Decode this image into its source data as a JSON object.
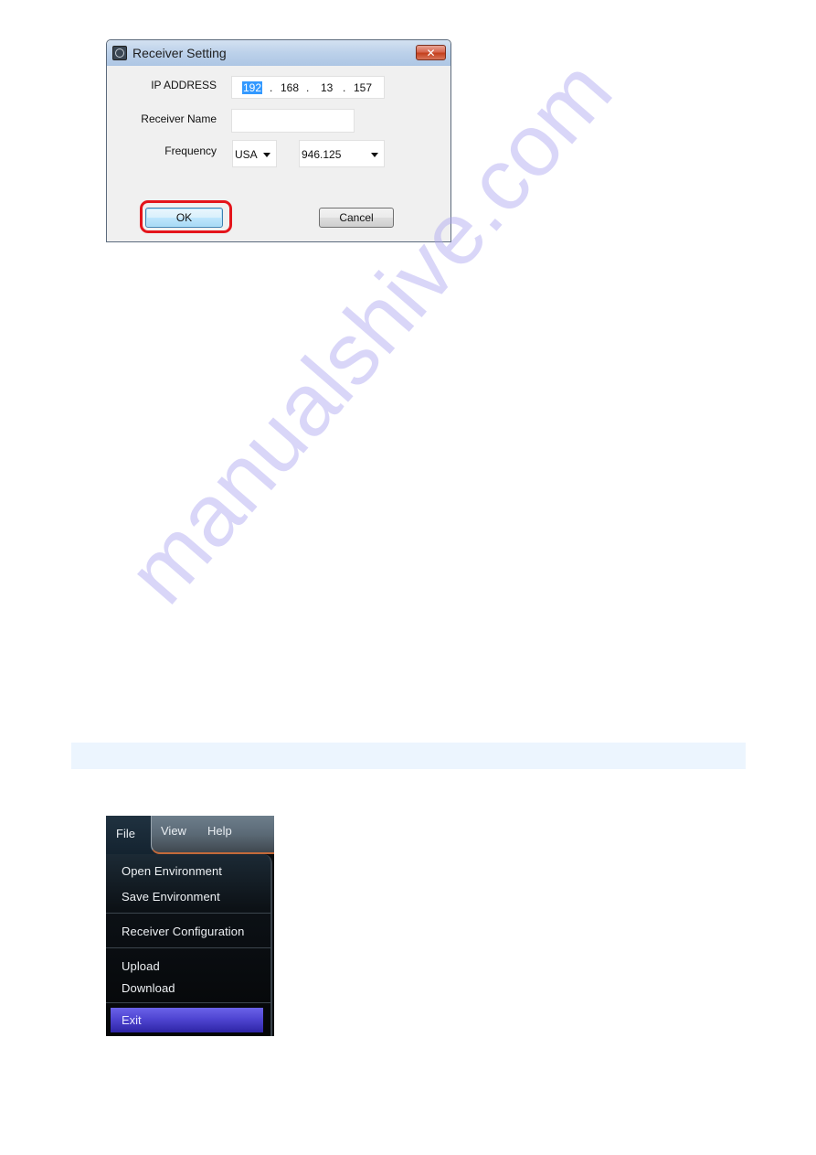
{
  "dialog": {
    "title": "Receiver Setting",
    "close_label": "✕",
    "fields": {
      "ip_label": "IP ADDRESS",
      "ip_parts": [
        "192",
        "168",
        "13",
        "157"
      ],
      "ip_separator": ".",
      "name_label": "Receiver Name",
      "name_value": "",
      "frequency_label": "Frequency",
      "region_value": "USA",
      "frequency_value": "946.125"
    },
    "buttons": {
      "ok": "OK",
      "cancel": "Cancel"
    },
    "highlight_color": "#e4141b"
  },
  "menu": {
    "bar": [
      "File",
      "View",
      "Help"
    ],
    "items": [
      {
        "label": "Open Environment"
      },
      {
        "label": "Save Environment"
      },
      {
        "label": "Receiver Configuration"
      },
      {
        "label": "Upload"
      },
      {
        "label": "Download"
      },
      {
        "label": "Exit",
        "selected": true
      }
    ],
    "selected_color": "#4f45d2"
  },
  "watermark": "manualshive.com"
}
